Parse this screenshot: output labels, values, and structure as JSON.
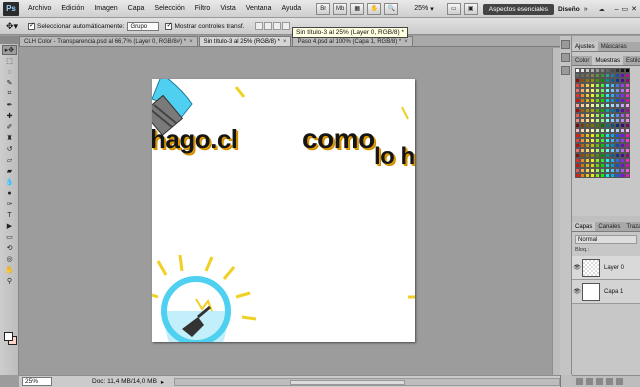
{
  "menu": {
    "logo": "Ps",
    "items": [
      "Archivo",
      "Edición",
      "Imagen",
      "Capa",
      "Selección",
      "Filtro",
      "Vista",
      "Ventana",
      "Ayuda"
    ],
    "zoom": "25%",
    "workspace_active": "Aspectos esenciales",
    "workspace_other": "Diseño"
  },
  "options": {
    "auto_select_label": "Seleccionar automáticamente:",
    "auto_select_value": "Grupo",
    "show_controls_label": "Mostrar controles transf."
  },
  "tooltip": "Sin título-3 al 25% (Layer 0, RGB/8) *",
  "tabs": [
    {
      "label": "CLH Color - Transparencia.psd al 66,7% (Layer 0, RGB/8#) *",
      "active": false
    },
    {
      "label": "Sin título-3 al 25% (RGB/8) *",
      "active": true
    },
    {
      "label": "Paso 4.psd al 100% (Capa 1, RGB/8) *",
      "active": false
    }
  ],
  "canvas_text": {
    "line1": "hago.cl",
    "line2": "como",
    "line3": "lo h"
  },
  "status": {
    "zoom": "25%",
    "doc": "Doc: 11,4 MB/14,0 MB"
  },
  "panels": {
    "top_tabs": [
      "Ajustes",
      "Máscaras"
    ],
    "swatch_tabs": [
      "Color",
      "Muestras",
      "Estilos"
    ],
    "layers_tabs": [
      "Capas",
      "Canales",
      "Trazados"
    ],
    "blend_mode": "Normal",
    "lock_label": "Bloq.:",
    "layers": [
      {
        "name": "Layer 0",
        "active": true
      },
      {
        "name": "Capa 1",
        "active": false
      }
    ]
  },
  "colors": {
    "bulb_cyan": "#4fd0f0",
    "ray_yellow": "#f0d020",
    "text_shadow": "#e8a000"
  }
}
